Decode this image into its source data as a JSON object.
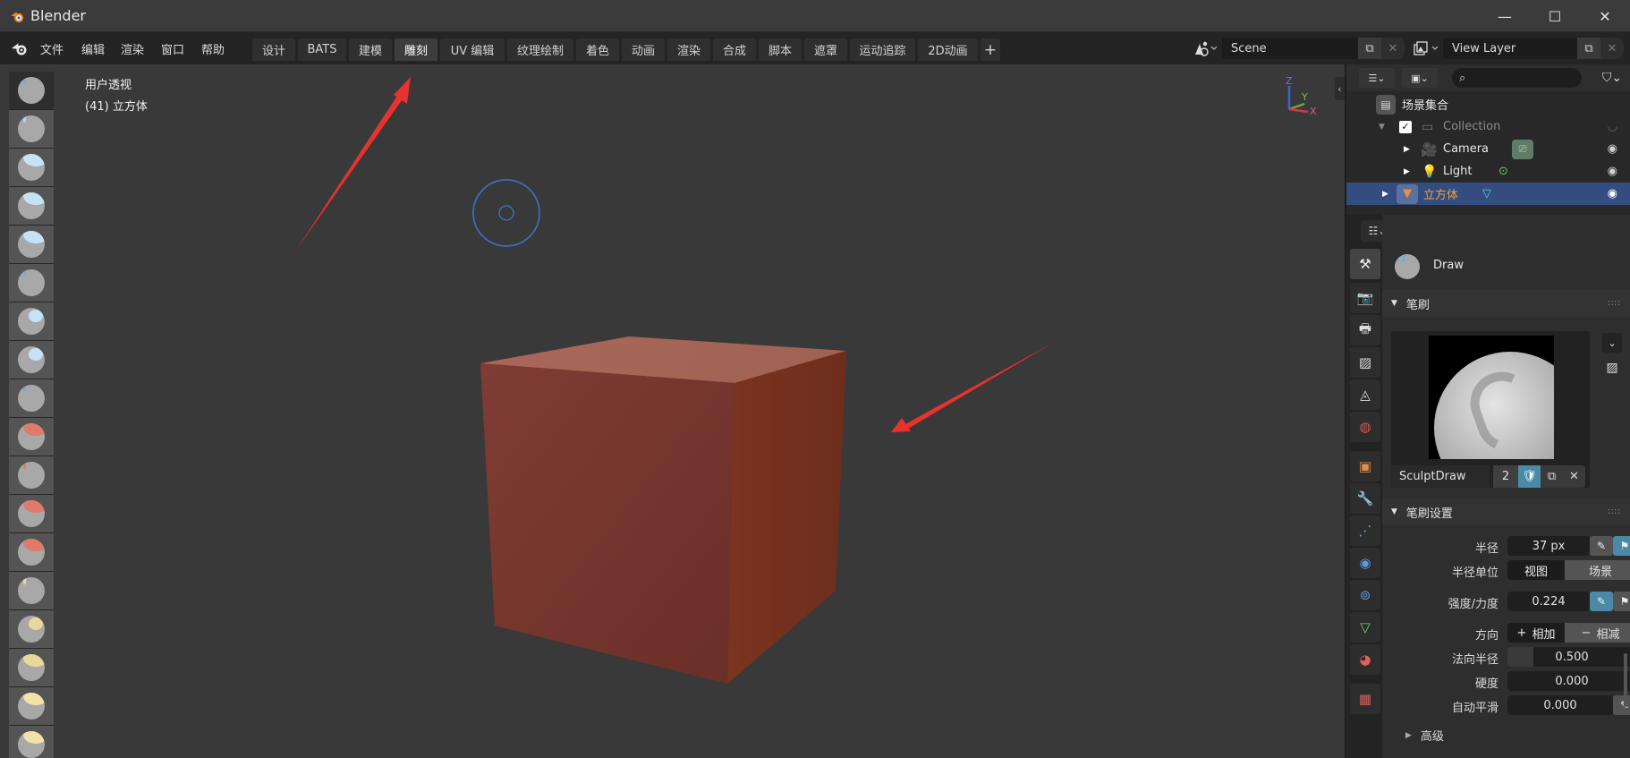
{
  "window": {
    "title": "Blender",
    "controls": {
      "minimize": "—",
      "maximize": "☐",
      "close": "✕"
    }
  },
  "menubar": {
    "menus": [
      "文件",
      "编辑",
      "渲染",
      "窗口",
      "帮助"
    ],
    "workspace_tabs": [
      {
        "label": "设计",
        "active": false
      },
      {
        "label": "BATS",
        "active": false
      },
      {
        "label": "建模",
        "active": false
      },
      {
        "label": "雕刻",
        "active": true
      },
      {
        "label": "UV 编辑",
        "active": false
      },
      {
        "label": "纹理绘制",
        "active": false
      },
      {
        "label": "着色",
        "active": false
      },
      {
        "label": "动画",
        "active": false
      },
      {
        "label": "渲染",
        "active": false
      },
      {
        "label": "合成",
        "active": false
      },
      {
        "label": "脚本",
        "active": false
      },
      {
        "label": "遮罩",
        "active": false
      },
      {
        "label": "运动追踪",
        "active": false
      },
      {
        "label": "2D动画",
        "active": false
      }
    ],
    "add_tab": "+",
    "scene": {
      "value": "Scene"
    },
    "view_layer": {
      "value": "View Layer"
    }
  },
  "viewport": {
    "view_name": "用户透视",
    "object_info": "(41) 立方体",
    "gizmo": {
      "z": "Z",
      "y": "Y",
      "x": "X"
    },
    "tools": [
      "draw",
      "draw-sharp",
      "clay",
      "clay-strips",
      "clay-thumb",
      "layer",
      "inflate",
      "blob",
      "crease",
      "smooth",
      "flatten",
      "fill",
      "scrape",
      "multiplane-scrape",
      "pinch",
      "grab",
      "elastic-deform",
      "snake-hook"
    ],
    "active_tool": "draw",
    "cube_color": "#8a3c2c",
    "annotation_color": "#e8322e"
  },
  "outliner": {
    "search_placeholder": "",
    "items": [
      {
        "label": "场景集合",
        "level": 0,
        "type": "scene-collection"
      },
      {
        "label": "Collection",
        "level": 1,
        "type": "collection",
        "checked": true
      },
      {
        "label": "Camera",
        "level": 2,
        "type": "camera"
      },
      {
        "label": "Light",
        "level": 2,
        "type": "light"
      },
      {
        "label": "立方体",
        "level": 1,
        "type": "mesh",
        "selected": true
      }
    ]
  },
  "properties": {
    "active_brush": "Draw",
    "brush_section": {
      "title": "笔刷",
      "brush_name": "SculptDraw",
      "users": "2"
    },
    "brush_settings": {
      "title": "笔刷设置",
      "radius": {
        "label": "半径",
        "value": "37 px"
      },
      "radius_unit": {
        "label": "半径单位",
        "options": [
          "视图",
          "场景"
        ],
        "selected": "视图"
      },
      "strength": {
        "label": "强度/力度",
        "value": "0.224"
      },
      "direction": {
        "label": "方向",
        "options": [
          "相加",
          "相减"
        ],
        "selected": "相加",
        "add_icon": "+",
        "sub_icon": "−"
      },
      "normal_radius": {
        "label": "法向半径",
        "value": "0.500"
      },
      "hardness": {
        "label": "硬度",
        "value": "0.000"
      },
      "autosmooth": {
        "label": "自动平滑",
        "value": "0.000"
      },
      "advanced": {
        "label": "高级"
      }
    }
  }
}
